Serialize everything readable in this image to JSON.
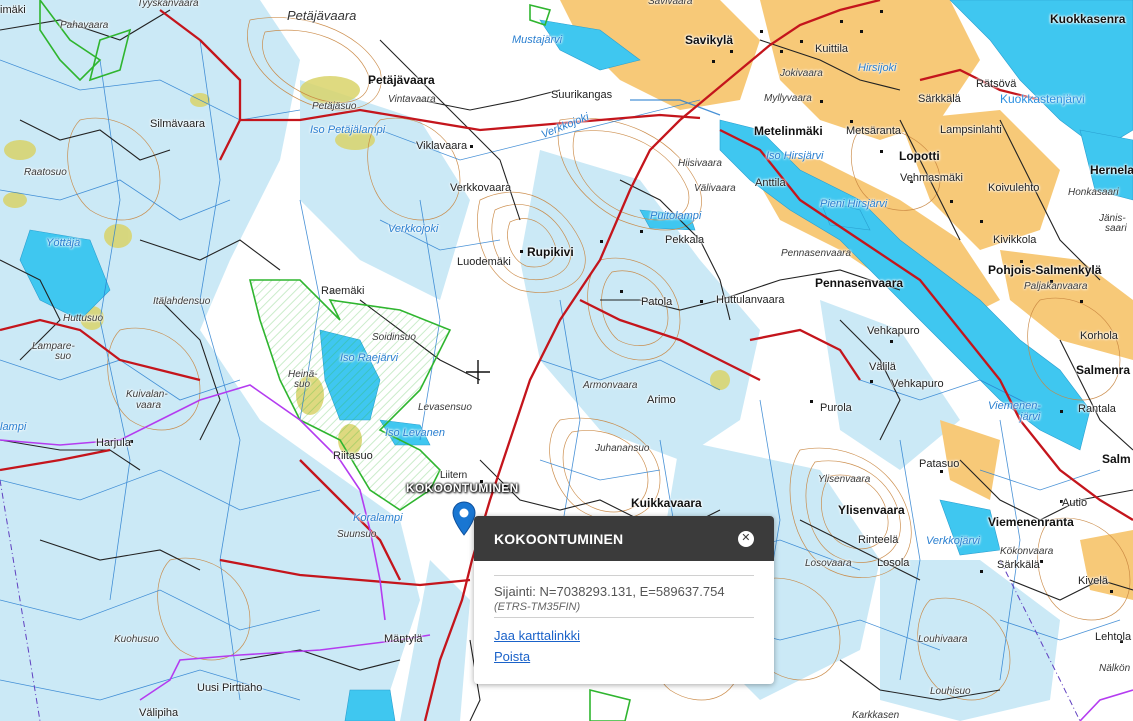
{
  "labels": {
    "places": [
      {
        "id": "tyyskanvaara",
        "text": "Tyyskänvaara",
        "kind": "terrain"
      },
      {
        "id": "pahavaara",
        "text": "Pahavaara",
        "kind": "terrain"
      },
      {
        "id": "petajavaara_big",
        "text": "Petäjävaara",
        "kind": "terrain-big"
      },
      {
        "id": "savivaara",
        "text": "Savivaara",
        "kind": "terrain"
      },
      {
        "id": "mustajarvi",
        "text": "Mustajärvi",
        "kind": "water"
      },
      {
        "id": "savikyla",
        "text": "Savikylä",
        "kind": "town"
      },
      {
        "id": "kuittila",
        "text": "Kuittila",
        "kind": "plain"
      },
      {
        "id": "hirsijoki",
        "text": "Hirsijoki",
        "kind": "water"
      },
      {
        "id": "kuokkasenranta",
        "text": "Kuokkasenra",
        "kind": "town"
      },
      {
        "id": "ratsova",
        "text": "Rätsövä",
        "kind": "plain"
      },
      {
        "id": "kuokkastenjarvi",
        "text": "Kuokkastenjärvi",
        "kind": "lake"
      },
      {
        "id": "petajavaara",
        "text": "Petäjävaara",
        "kind": "town"
      },
      {
        "id": "vintavaara",
        "text": "Vintavaara",
        "kind": "terrain"
      },
      {
        "id": "suurikangas",
        "text": "Suurikangas",
        "kind": "plain"
      },
      {
        "id": "jokivaara",
        "text": "Jokivaara",
        "kind": "terrain"
      },
      {
        "id": "myllyvaara",
        "text": "Myllyvaara",
        "kind": "terrain"
      },
      {
        "id": "sarkkala",
        "text": "Särkkälä",
        "kind": "plain"
      },
      {
        "id": "petajasuo",
        "text": "Petäjäsuo",
        "kind": "terrain"
      },
      {
        "id": "isopetajalampi",
        "text": "Iso Petäjälampi",
        "kind": "water"
      },
      {
        "id": "silmavaara",
        "text": "Silmävaara",
        "kind": "plain"
      },
      {
        "id": "verkkojoki1",
        "text": "Verkkojoki",
        "kind": "water"
      },
      {
        "id": "metelinmaki",
        "text": "Metelinmäki",
        "kind": "town"
      },
      {
        "id": "metsaranta",
        "text": "Metsäranta",
        "kind": "plain"
      },
      {
        "id": "lampsinlahti",
        "text": "Lampsinlahti",
        "kind": "plain"
      },
      {
        "id": "viklavaara",
        "text": "Viklavaara",
        "kind": "plain"
      },
      {
        "id": "isohirsjarvi",
        "text": "Iso Hirsjärvi",
        "kind": "water"
      },
      {
        "id": "lopotti",
        "text": "Lopotti",
        "kind": "town"
      },
      {
        "id": "hernelahti",
        "text": "Hernela",
        "kind": "town"
      },
      {
        "id": "hiisivaara",
        "text": "Hiisivaara",
        "kind": "terrain"
      },
      {
        "id": "raatosuo",
        "text": "Raatosuo",
        "kind": "terrain"
      },
      {
        "id": "verkkovaara",
        "text": "Verkkovaara",
        "kind": "plain"
      },
      {
        "id": "valivaara",
        "text": "Välivaara",
        "kind": "terrain"
      },
      {
        "id": "anttila",
        "text": "Anttila",
        "kind": "plain"
      },
      {
        "id": "vehmasmaki",
        "text": "Vehmasmäki",
        "kind": "plain"
      },
      {
        "id": "koivulehto",
        "text": "Koivulehto",
        "kind": "plain"
      },
      {
        "id": "honkasaari",
        "text": "Honkasaari",
        "kind": "terrain"
      },
      {
        "id": "pienihirsjarvi",
        "text": "Pieni Hirsjärvi",
        "kind": "water"
      },
      {
        "id": "puitolampi",
        "text": "Puitolampi",
        "kind": "water"
      },
      {
        "id": "janissaari",
        "text": "Jänis-",
        "kind": "terrain"
      },
      {
        "id": "janissaari2",
        "text": "saari",
        "kind": "terrain"
      },
      {
        "id": "verkkojoki2",
        "text": "Verkkojoki",
        "kind": "water"
      },
      {
        "id": "yottaja",
        "text": "Yöttäjä",
        "kind": "water"
      },
      {
        "id": "rupikivi",
        "text": "Rupikivi",
        "kind": "town"
      },
      {
        "id": "pekkala",
        "text": "Pekkala",
        "kind": "plain"
      },
      {
        "id": "kivikkola",
        "text": "Kivikkola",
        "kind": "plain"
      },
      {
        "id": "pennasenvaara_t",
        "text": "Pennasenvaara",
        "kind": "terrain"
      },
      {
        "id": "luodemaki",
        "text": "Luodemäki",
        "kind": "plain"
      },
      {
        "id": "pohjoissalmenkyla",
        "text": "Pohjois-Salmenkylä",
        "kind": "town"
      },
      {
        "id": "pennasenvaara",
        "text": "Pennasenvaara",
        "kind": "town"
      },
      {
        "id": "paljakanvaara",
        "text": "Paljakanvaara",
        "kind": "terrain"
      },
      {
        "id": "raemaki",
        "text": "Raemäki",
        "kind": "plain"
      },
      {
        "id": "italahdensuo",
        "text": "Itälahdensuo",
        "kind": "terrain"
      },
      {
        "id": "patola",
        "text": "Patola",
        "kind": "plain"
      },
      {
        "id": "huttulanvaara",
        "text": "Huttulanvaara",
        "kind": "plain"
      },
      {
        "id": "huttusuo",
        "text": "Huttusuo",
        "kind": "terrain"
      },
      {
        "id": "soidinsuo",
        "text": "Soidinsuo",
        "kind": "terrain"
      },
      {
        "id": "vehkapuro1",
        "text": "Vehkapuro",
        "kind": "plain"
      },
      {
        "id": "korhola",
        "text": "Korhola",
        "kind": "plain"
      },
      {
        "id": "lamparesuo",
        "text": "Lampare-",
        "kind": "terrain"
      },
      {
        "id": "lamparesuo2",
        "text": "suo",
        "kind": "terrain"
      },
      {
        "id": "isoraejarvi",
        "text": "Iso Raejärvi",
        "kind": "water"
      },
      {
        "id": "valila",
        "text": "Välilä",
        "kind": "plain"
      },
      {
        "id": "salmenranta",
        "text": "Salmenra",
        "kind": "town"
      },
      {
        "id": "heinasuo",
        "text": "Heinä-",
        "kind": "terrain"
      },
      {
        "id": "heinasuo2",
        "text": "suo",
        "kind": "terrain"
      },
      {
        "id": "armonvaara",
        "text": "Armonvaara",
        "kind": "terrain"
      },
      {
        "id": "vehkapuro2",
        "text": "Vehkapuro",
        "kind": "plain"
      },
      {
        "id": "kuivalanvaara",
        "text": "Kuivalan-",
        "kind": "terrain"
      },
      {
        "id": "kuivalanvaara2",
        "text": "vaara",
        "kind": "terrain"
      },
      {
        "id": "arimo",
        "text": "Arimo",
        "kind": "plain"
      },
      {
        "id": "purola",
        "text": "Purola",
        "kind": "plain"
      },
      {
        "id": "viemenenjarvi",
        "text": "Viemenen-",
        "kind": "water"
      },
      {
        "id": "viemenenjarvi2",
        "text": "järvi",
        "kind": "water"
      },
      {
        "id": "rantala",
        "text": "Rantala",
        "kind": "plain"
      },
      {
        "id": "levasensuo",
        "text": "Levasensuo",
        "kind": "terrain"
      },
      {
        "id": "harjula",
        "text": "Harjula",
        "kind": "plain"
      },
      {
        "id": "isolevanen",
        "text": "Iso Levanen",
        "kind": "water"
      },
      {
        "id": "juhanansuo",
        "text": "Juhanansuo",
        "kind": "terrain"
      },
      {
        "id": "riitasuo",
        "text": "Riitasuo",
        "kind": "plain"
      },
      {
        "id": "patasuo",
        "text": "Patasuo",
        "kind": "plain"
      },
      {
        "id": "salm",
        "text": "Salm",
        "kind": "town"
      },
      {
        "id": "lamp",
        "text": "lampi",
        "kind": "water"
      },
      {
        "id": "liitteri",
        "text": "Liitern",
        "kind": "plain"
      },
      {
        "id": "ylisenvaara_t",
        "text": "Ylisenvaara",
        "kind": "terrain"
      },
      {
        "id": "kokoontuminen_map",
        "text": "KOKOONTUMINEN",
        "kind": "white"
      },
      {
        "id": "kuikkavaara",
        "text": "Kuikkavaara",
        "kind": "town"
      },
      {
        "id": "autio",
        "text": "Autio",
        "kind": "plain"
      },
      {
        "id": "ylisenvaara",
        "text": "Ylisenvaara",
        "kind": "town"
      },
      {
        "id": "koralampi",
        "text": "Koralampi",
        "kind": "water"
      },
      {
        "id": "viemenenranta",
        "text": "Viemenenranta",
        "kind": "town"
      },
      {
        "id": "suunsuo",
        "text": "Suunsuo",
        "kind": "terrain"
      },
      {
        "id": "rinteela",
        "text": "Rinteelä",
        "kind": "plain"
      },
      {
        "id": "verkkojarvi",
        "text": "Verkkojärvi",
        "kind": "water"
      },
      {
        "id": "kokonvaara",
        "text": "Kökonvaara",
        "kind": "terrain"
      },
      {
        "id": "losovaara",
        "text": "Losovaara",
        "kind": "terrain"
      },
      {
        "id": "losola",
        "text": "Losola",
        "kind": "plain"
      },
      {
        "id": "sarkkala2",
        "text": "Särkkälä",
        "kind": "plain"
      },
      {
        "id": "kivela",
        "text": "Kivelä",
        "kind": "plain"
      },
      {
        "id": "kuohusuo",
        "text": "Kuohusuo",
        "kind": "terrain"
      },
      {
        "id": "mantyla",
        "text": "Mäntylä",
        "kind": "plain"
      },
      {
        "id": "louhivaara",
        "text": "Louhivaara",
        "kind": "terrain"
      },
      {
        "id": "lehtola",
        "text": "Lehtola",
        "kind": "plain"
      },
      {
        "id": "nalkon",
        "text": "Nälkön",
        "kind": "terrain"
      },
      {
        "id": "uusipirttiaho",
        "text": "Uusi Pirttiaho",
        "kind": "plain"
      },
      {
        "id": "louhisuo",
        "text": "Louhisuo",
        "kind": "terrain"
      },
      {
        "id": "valipiha",
        "text": "Välipiha",
        "kind": "plain"
      },
      {
        "id": "karkkasen",
        "text": "Karkkasen",
        "kind": "terrain"
      },
      {
        "id": "imaki",
        "text": "imäki",
        "kind": "plain"
      }
    ]
  },
  "popup": {
    "title": "KOKOONTUMINEN",
    "location": "Sijainti: N=7038293.131, E=589637.754",
    "projection": "(ETRS-TM35FIN)",
    "share_link": "Jaa karttalinkki",
    "delete_link": "Poista"
  },
  "colors": {
    "water": "#3fc7f0",
    "marsh": "#cbe9f6",
    "field": "#f7c978",
    "contour": "#c8853f",
    "road_major": "#c4151c",
    "stream": "#2a7fd0",
    "reserve": "#2fb52f",
    "boundary": "#b43cf0",
    "marker": "#1976d2"
  }
}
